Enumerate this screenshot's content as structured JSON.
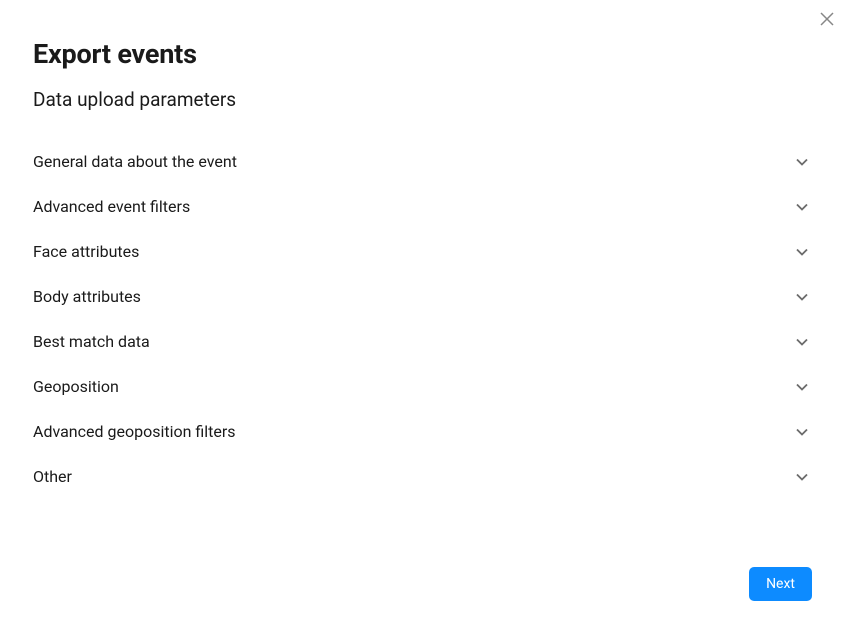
{
  "modal": {
    "title": "Export events",
    "subtitle": "Data upload parameters",
    "sections": [
      {
        "label": "General data about the event"
      },
      {
        "label": "Advanced event filters"
      },
      {
        "label": "Face attributes"
      },
      {
        "label": "Body attributes"
      },
      {
        "label": "Best match data"
      },
      {
        "label": "Geoposition"
      },
      {
        "label": "Advanced geoposition filters"
      },
      {
        "label": "Other"
      }
    ],
    "next_button": "Next"
  }
}
